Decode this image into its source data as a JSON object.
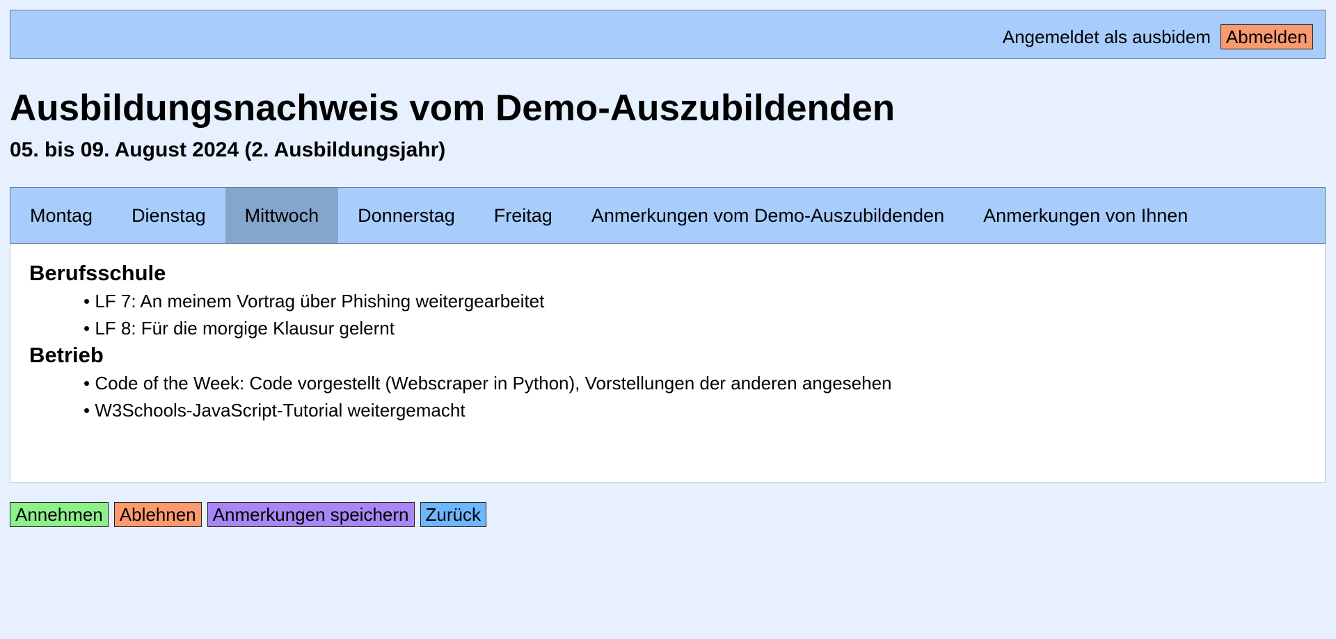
{
  "header": {
    "logged_in_text": "Angemeldet als ausbidem",
    "logout_label": "Abmelden"
  },
  "page": {
    "title": "Ausbildungsnachweis vom Demo-Auszubildenden",
    "subtitle": "05. bis 09. August 2024 (2. Ausbildungsjahr)"
  },
  "tabs": [
    {
      "label": "Montag",
      "active": false
    },
    {
      "label": "Dienstag",
      "active": false
    },
    {
      "label": "Mittwoch",
      "active": true
    },
    {
      "label": "Donnerstag",
      "active": false
    },
    {
      "label": "Freitag",
      "active": false
    },
    {
      "label": "Anmerkungen vom Demo-Auszubildenden",
      "active": false
    },
    {
      "label": "Anmerkungen von Ihnen",
      "active": false
    }
  ],
  "content": {
    "sections": [
      {
        "heading": "Berufsschule",
        "items": [
          "LF 7: An meinem Vortrag über Phishing weitergearbeitet",
          "LF 8: Für die morgige Klausur gelernt"
        ]
      },
      {
        "heading": "Betrieb",
        "items": [
          "Code of the Week: Code vorgestellt (Webscraper in Python), Vorstellungen der anderen angesehen",
          "W3Schools-JavaScript-Tutorial weitergemacht"
        ]
      }
    ]
  },
  "actions": {
    "accept_label": "Annehmen",
    "reject_label": "Ablehnen",
    "save_label": "Anmerkungen speichern",
    "back_label": "Zurück"
  },
  "colors": {
    "page_background": "#e6f0fe",
    "bar_background": "#a8cdfd",
    "active_tab": "#85a6cc",
    "accept": "#8ef08b",
    "reject": "#fb9a6f",
    "save": "#a886f3",
    "back": "#6eb6fd"
  }
}
